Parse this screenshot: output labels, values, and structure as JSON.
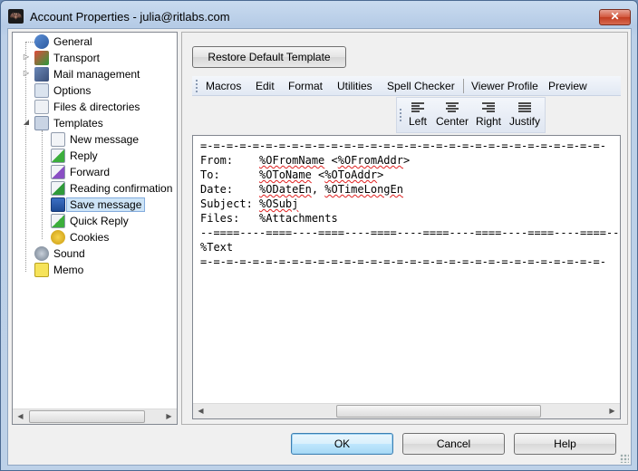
{
  "window": {
    "title": "Account Properties - julia@ritlabs.com",
    "close_label": "✕"
  },
  "tree": {
    "items": [
      {
        "label": "General"
      },
      {
        "label": "Transport"
      },
      {
        "label": "Mail management"
      },
      {
        "label": "Options"
      },
      {
        "label": "Files & directories"
      },
      {
        "label": "Templates"
      },
      {
        "label": "New message"
      },
      {
        "label": "Reply"
      },
      {
        "label": "Forward"
      },
      {
        "label": "Reading confirmation"
      },
      {
        "label": "Save message"
      },
      {
        "label": "Quick Reply"
      },
      {
        "label": "Cookies"
      },
      {
        "label": "Sound"
      },
      {
        "label": "Memo"
      }
    ]
  },
  "panel": {
    "restore_label": "Restore Default Template",
    "menu": [
      "Macros",
      "Edit",
      "Format",
      "Utilities",
      "Spell Checker",
      "Viewer Profile",
      "Preview"
    ],
    "align": [
      "Left",
      "Center",
      "Right",
      "Justify"
    ]
  },
  "template": {
    "rule_top": "=-=-=-=-=-=-=-=-=-=-=-=-=-=-=-=-=-=-=-=-=-=-=-=-=-=-=-=-=-=-=-",
    "from_label": "From:    ",
    "from_macro1": "%OFromName",
    "from_mid": " <",
    "from_macro2": "%OFromAddr",
    "from_end": ">",
    "to_label": "To:      ",
    "to_macro1": "%OToName",
    "to_mid": " <",
    "to_macro2": "%OToAddr",
    "to_end": ">",
    "date_label": "Date:    ",
    "date_macro1": "%ODateEn",
    "date_mid": ", ",
    "date_macro2": "%OTimeLongEn",
    "subject_label": "Subject: ",
    "subject_macro": "%OSubj",
    "files_line": "Files:   %Attachments",
    "rule_mid": "--====----====----====----====----====----====----====----====--",
    "text_line": "%Text",
    "rule_bottom": "=-=-=-=-=-=-=-=-=-=-=-=-=-=-=-=-=-=-=-=-=-=-=-=-=-=-=-=-=-=-=-"
  },
  "buttons": {
    "ok": "OK",
    "cancel": "Cancel",
    "help": "Help"
  }
}
